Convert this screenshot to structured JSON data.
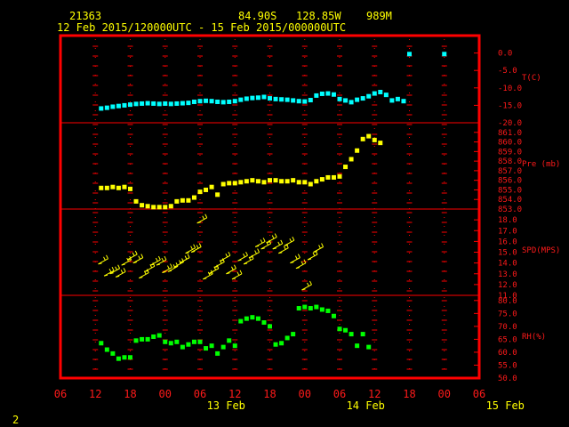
{
  "header": {
    "station": "21363",
    "lat": "84.90S",
    "lon": "128.85W",
    "elev": "989M",
    "period": "12 Feb 2015/120000UTC - 15 Feb 2015/000000UTC"
  },
  "footer_number": "2",
  "colors": {
    "frame": "#ff0000",
    "label": "#ff1a1a",
    "temp": "#00ffff",
    "pres": "#ffff00",
    "wind": "#ffff00",
    "rh": "#00ff00",
    "header_text": "#ffff00"
  },
  "chart_data": {
    "type": "scatter",
    "x_unit": "hours since 12 Feb 2015 00 UTC",
    "x_range": [
      6,
      78
    ],
    "x_tick_labels": [
      "06",
      "12",
      "18",
      "00",
      "06",
      "12",
      "18",
      "00",
      "06",
      "12",
      "18",
      "00",
      "06"
    ],
    "date_labels": [
      {
        "hour": 36,
        "label": "13 Feb"
      },
      {
        "hour": 60,
        "label": "14 Feb"
      },
      {
        "hour": 84,
        "label": "15 Feb"
      }
    ],
    "panels": [
      {
        "name": "T(C)",
        "ylim": [
          -20,
          5
        ],
        "ticks": [
          "0.0",
          "-5.0",
          "-10.0",
          "-15.0",
          "-20.0"
        ],
        "tick_values": [
          0,
          -5,
          -10,
          -15,
          -20
        ],
        "points": [
          [
            13,
            -15.9
          ],
          [
            14,
            -15.7
          ],
          [
            15,
            -15.4
          ],
          [
            16,
            -15.2
          ],
          [
            17,
            -15.0
          ],
          [
            18,
            -14.8
          ],
          [
            19,
            -14.6
          ],
          [
            20,
            -14.5
          ],
          [
            21,
            -14.4
          ],
          [
            22,
            -14.5
          ],
          [
            23,
            -14.6
          ],
          [
            24,
            -14.5
          ],
          [
            25,
            -14.6
          ],
          [
            26,
            -14.5
          ],
          [
            27,
            -14.4
          ],
          [
            28,
            -14.3
          ],
          [
            29,
            -14.0
          ],
          [
            30,
            -13.8
          ],
          [
            31,
            -13.7
          ],
          [
            32,
            -13.8
          ],
          [
            33,
            -14.0
          ],
          [
            34,
            -14.1
          ],
          [
            35,
            -14.0
          ],
          [
            36,
            -13.8
          ],
          [
            37,
            -13.4
          ],
          [
            38,
            -13.1
          ],
          [
            39,
            -12.9
          ],
          [
            40,
            -12.8
          ],
          [
            41,
            -12.6
          ],
          [
            42,
            -13.0
          ],
          [
            43,
            -13.2
          ],
          [
            44,
            -13.3
          ],
          [
            45,
            -13.4
          ],
          [
            46,
            -13.6
          ],
          [
            47,
            -13.8
          ],
          [
            48,
            -13.9
          ],
          [
            49,
            -13.5
          ],
          [
            50,
            -12.2
          ],
          [
            51,
            -11.7
          ],
          [
            52,
            -11.6
          ],
          [
            53,
            -11.9
          ],
          [
            54,
            -13.2
          ],
          [
            55,
            -13.6
          ],
          [
            56,
            -14.1
          ],
          [
            57,
            -13.4
          ],
          [
            58,
            -13.0
          ],
          [
            59,
            -12.4
          ],
          [
            60,
            -11.6
          ],
          [
            61,
            -11.2
          ],
          [
            62,
            -12.0
          ],
          [
            63,
            -13.6
          ],
          [
            64,
            -13.2
          ],
          [
            65,
            -13.8
          ],
          [
            66,
            -0.3
          ],
          [
            72,
            -0.3
          ]
        ]
      },
      {
        "name": "Pre (mb)",
        "ylim": [
          853,
          862
        ],
        "ticks": [
          "861.0",
          "860.0",
          "859.0",
          "858.0",
          "857.0",
          "856.0",
          "855.0",
          "854.0",
          "853.0"
        ],
        "tick_values": [
          861,
          860,
          859,
          858,
          857,
          856,
          855,
          854,
          853
        ],
        "points": [
          [
            13,
            855.2
          ],
          [
            14,
            855.2
          ],
          [
            15,
            855.3
          ],
          [
            16,
            855.2
          ],
          [
            17,
            855.3
          ],
          [
            18,
            855.1
          ],
          [
            19,
            853.8
          ],
          [
            20,
            853.4
          ],
          [
            21,
            853.3
          ],
          [
            22,
            853.2
          ],
          [
            23,
            853.2
          ],
          [
            24,
            853.2
          ],
          [
            25,
            853.3
          ],
          [
            26,
            853.8
          ],
          [
            27,
            853.9
          ],
          [
            28,
            853.9
          ],
          [
            29,
            854.2
          ],
          [
            30,
            854.8
          ],
          [
            31,
            855.0
          ],
          [
            32,
            855.3
          ],
          [
            33,
            854.5
          ],
          [
            34,
            855.6
          ],
          [
            35,
            855.7
          ],
          [
            36,
            855.7
          ],
          [
            37,
            855.8
          ],
          [
            38,
            855.9
          ],
          [
            39,
            856.0
          ],
          [
            40,
            855.9
          ],
          [
            41,
            855.8
          ],
          [
            42,
            856.0
          ],
          [
            43,
            856.0
          ],
          [
            44,
            855.9
          ],
          [
            45,
            855.9
          ],
          [
            46,
            856.0
          ],
          [
            47,
            855.8
          ],
          [
            48,
            855.8
          ],
          [
            49,
            855.6
          ],
          [
            50,
            855.9
          ],
          [
            51,
            856.1
          ],
          [
            52,
            856.3
          ],
          [
            53,
            856.3
          ],
          [
            54,
            856.4
          ],
          [
            55,
            857.4
          ],
          [
            56,
            858.2
          ],
          [
            57,
            859.1
          ],
          [
            58,
            860.3
          ],
          [
            59,
            860.6
          ],
          [
            60,
            860.2
          ],
          [
            61,
            859.9
          ]
        ]
      },
      {
        "name": "SPD(MPS)",
        "ylim": [
          11,
          19
        ],
        "ticks": [
          "18.0",
          "17.0",
          "16.0",
          "15.0",
          "14.0",
          "13.0",
          "12.0",
          "11.0"
        ],
        "tick_values": [
          18,
          17,
          16,
          15,
          14,
          13,
          12,
          11
        ],
        "points": [
          [
            12.5,
            13.9
          ],
          [
            13.5,
            12.8
          ],
          [
            14.5,
            13.0
          ],
          [
            15.5,
            12.7
          ],
          [
            16.5,
            13.8
          ],
          [
            17.5,
            14.3
          ],
          [
            18.5,
            14.0
          ],
          [
            19.5,
            12.6
          ],
          [
            20.5,
            13.2
          ],
          [
            21.5,
            13.8
          ],
          [
            22.5,
            13.8
          ],
          [
            23.5,
            13.1
          ],
          [
            24.5,
            13.2
          ],
          [
            25.5,
            13.6
          ],
          [
            26.5,
            14.0
          ],
          [
            27.5,
            14.9
          ],
          [
            28.5,
            15.0
          ],
          [
            29.5,
            17.7
          ],
          [
            30.5,
            12.5
          ],
          [
            31.5,
            13.0
          ],
          [
            32.5,
            13.6
          ],
          [
            33.5,
            14.2
          ],
          [
            34.5,
            13.0
          ],
          [
            35.5,
            12.5
          ],
          [
            36.5,
            14.2
          ],
          [
            37.5,
            13.9
          ],
          [
            38.5,
            14.5
          ],
          [
            39.5,
            15.5
          ],
          [
            40.5,
            15.3
          ],
          [
            41.5,
            15.9
          ],
          [
            42.5,
            15.3
          ],
          [
            43.5,
            14.9
          ],
          [
            44.5,
            15.6
          ],
          [
            45.5,
            14.0
          ],
          [
            46.5,
            13.5
          ],
          [
            47.5,
            11.5
          ],
          [
            48.5,
            14.3
          ],
          [
            49.5,
            15.0
          ]
        ]
      },
      {
        "name": "RH(%)",
        "ylim": [
          50,
          82
        ],
        "ticks": [
          "80.0",
          "75.0",
          "70.0",
          "65.0",
          "60.0",
          "55.0",
          "50.0"
        ],
        "tick_values": [
          80,
          75,
          70,
          65,
          60,
          55,
          50
        ],
        "points": [
          [
            13,
            63.5
          ],
          [
            14,
            61.0
          ],
          [
            15,
            59.5
          ],
          [
            16,
            57.5
          ],
          [
            17,
            58.0
          ],
          [
            18,
            58.0
          ],
          [
            19,
            64.5
          ],
          [
            20,
            65.0
          ],
          [
            21,
            65.0
          ],
          [
            22,
            66.0
          ],
          [
            23,
            66.5
          ],
          [
            24,
            64.0
          ],
          [
            25,
            63.5
          ],
          [
            26,
            64.0
          ],
          [
            27,
            62.0
          ],
          [
            28,
            63.0
          ],
          [
            29,
            64.0
          ],
          [
            30,
            64.0
          ],
          [
            31,
            61.5
          ],
          [
            32,
            62.5
          ],
          [
            33,
            59.5
          ],
          [
            34,
            62.0
          ],
          [
            35,
            64.5
          ],
          [
            36,
            62.5
          ],
          [
            37,
            72.0
          ],
          [
            38,
            73.0
          ],
          [
            39,
            73.5
          ],
          [
            40,
            73.0
          ],
          [
            41,
            71.5
          ],
          [
            42,
            70.0
          ],
          [
            43,
            63.0
          ],
          [
            44,
            63.5
          ],
          [
            45,
            65.5
          ],
          [
            46,
            67.0
          ],
          [
            47,
            77.0
          ],
          [
            48,
            77.5
          ],
          [
            49,
            77.0
          ],
          [
            50,
            77.5
          ],
          [
            51,
            76.5
          ],
          [
            52,
            76.0
          ],
          [
            53,
            74.0
          ],
          [
            54,
            69.0
          ],
          [
            55,
            68.5
          ],
          [
            56,
            67.0
          ],
          [
            57,
            62.5
          ],
          [
            58,
            67.0
          ],
          [
            59,
            62.0
          ]
        ]
      }
    ]
  }
}
